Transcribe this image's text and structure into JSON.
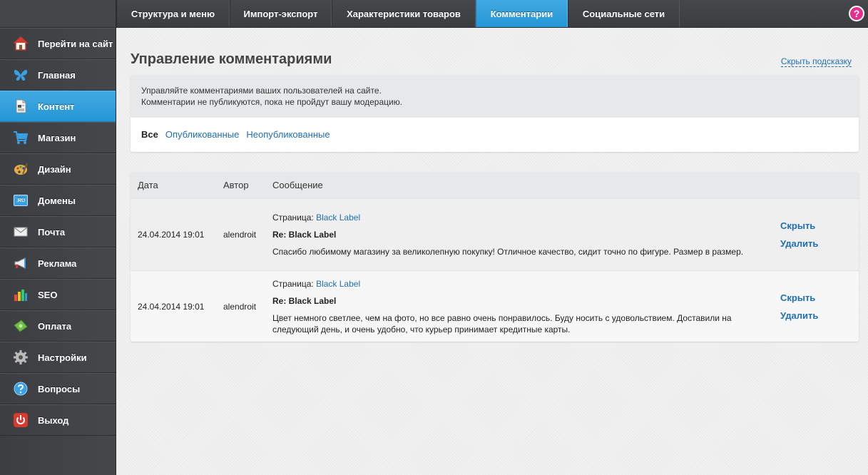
{
  "topnav": {
    "tabs": [
      {
        "label": "Структура и меню",
        "active": false
      },
      {
        "label": "Импорт-экспорт",
        "active": false
      },
      {
        "label": "Характеристики товаров",
        "active": false
      },
      {
        "label": "Комментарии",
        "active": true
      },
      {
        "label": "Социальные сети",
        "active": false
      }
    ],
    "help_label": "?"
  },
  "sidebar": {
    "items": [
      {
        "label": "Перейти на сайт",
        "icon": "home-icon"
      },
      {
        "label": "Главная",
        "icon": "butterfly-icon"
      },
      {
        "label": "Контент",
        "icon": "document-icon",
        "active": true
      },
      {
        "label": "Магазин",
        "icon": "cart-icon"
      },
      {
        "label": "Дизайн",
        "icon": "palette-icon"
      },
      {
        "label": "Домены",
        "icon": "domain-icon"
      },
      {
        "label": "Почта",
        "icon": "mail-icon"
      },
      {
        "label": "Реклама",
        "icon": "megaphone-icon"
      },
      {
        "label": "SEO",
        "icon": "bars-icon"
      },
      {
        "label": "Оплата",
        "icon": "money-icon"
      },
      {
        "label": "Настройки",
        "icon": "gear-icon"
      },
      {
        "label": "Вопросы",
        "icon": "question-icon"
      },
      {
        "label": "Выход",
        "icon": "power-icon"
      }
    ],
    "domain_icon_text": ".RU"
  },
  "main": {
    "title": "Управление комментариями",
    "hide_hint": "Скрыть подсказку",
    "hint_lines": [
      "Управляйте комментариями ваших пользователей на сайте.",
      "Комментарии не публикуются, пока не пройдут вашу модерацию."
    ],
    "filters": {
      "current": "Все",
      "links": [
        "Опубликованные",
        "Неопубликованные"
      ]
    },
    "table": {
      "headers": {
        "date": "Дата",
        "author": "Автор",
        "message": "Сообщение"
      },
      "rows": [
        {
          "date": "24.04.2014 19:01",
          "author": "alendroit",
          "page_label": "Страница:",
          "page_link": "Black Label",
          "title": "Re: Black Label",
          "text": "Спасибо любимому магазину за великолепную покупку! Отличное качество, сидит точно по фигуре. Размер в размер.",
          "hide": "Скрыть",
          "delete": "Удалить"
        },
        {
          "date": "24.04.2014 19:01",
          "author": "alendroit",
          "page_label": "Страница:",
          "page_link": "Black Label",
          "title": "Re: Black Label",
          "text": "Цвет немного светлее, чем на фото, но все равно очень понравилось. Буду носить с удовольствием. Доставили на следующий день, и очень удобно, что курьер принимает кредитные карты.",
          "hide": "Скрыть",
          "delete": "Удалить"
        }
      ]
    }
  },
  "colors": {
    "accent": "#2a9bd9",
    "link": "#1f6fb5",
    "sidebar_bg": "#3f4145",
    "help": "#e4308c"
  }
}
